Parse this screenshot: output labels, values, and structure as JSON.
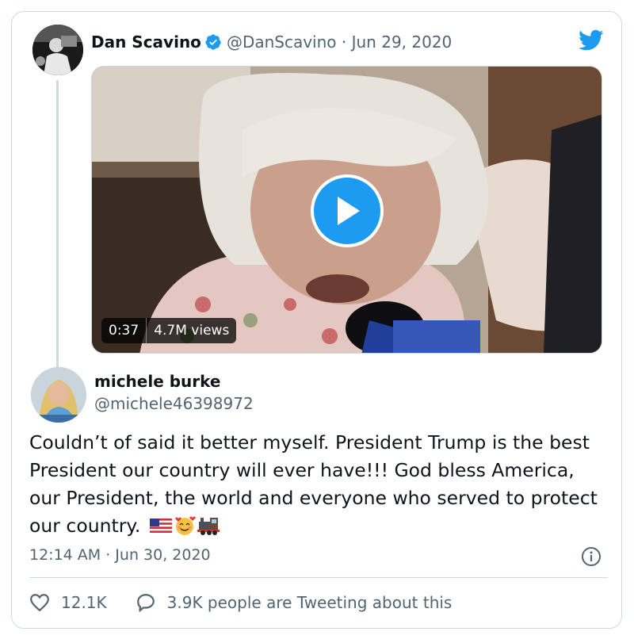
{
  "parent_tweet": {
    "author_name": "Dan Scavino",
    "handle": "@DanScavino",
    "date": "Jun 29, 2020",
    "video": {
      "duration": "0:37",
      "views": "4.7M views"
    }
  },
  "reply_tweet": {
    "author_name": "michele burke",
    "handle": "@michele46398972",
    "text": "Couldn’t of said it better myself. President Trump is the best President our country will ever have!!! God bless America, our President, the world and everyone who served to protect our country.",
    "emojis": [
      "us-flag-icon",
      "smiling-face-with-hearts-icon",
      "locomotive-icon"
    ],
    "timestamp": "12:14 AM · Jun 30, 2020"
  },
  "actions": {
    "likes": "12.1K",
    "conversation": "3.9K people are Tweeting about this"
  },
  "colors": {
    "accent": "#1d9bf0",
    "secondary_text": "#536471",
    "border": "#cfd9de"
  }
}
